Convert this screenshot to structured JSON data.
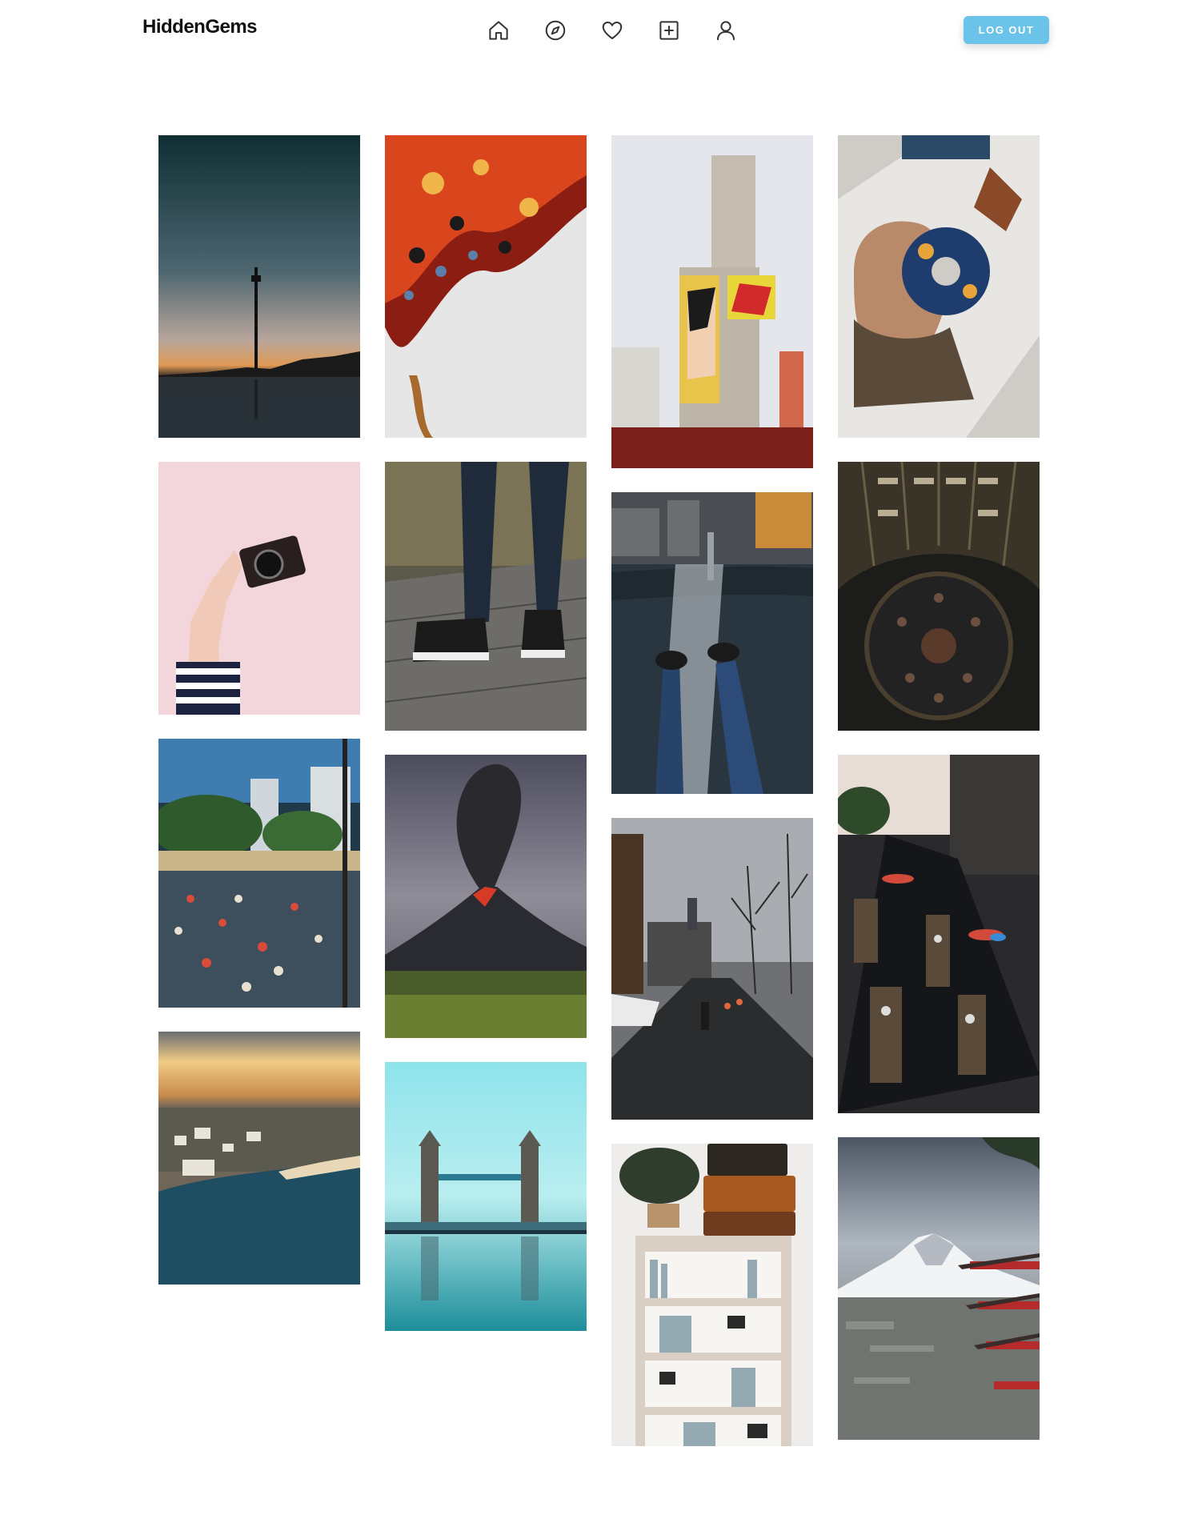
{
  "app": {
    "brand": "HiddenGems"
  },
  "nav": {
    "items": [
      {
        "name": "home",
        "icon": "home-icon"
      },
      {
        "name": "explore",
        "icon": "compass-icon"
      },
      {
        "name": "favorites",
        "icon": "heart-icon"
      },
      {
        "name": "add-post",
        "icon": "plus-square-icon"
      },
      {
        "name": "profile",
        "icon": "user-icon"
      }
    ],
    "logout_label": "LOG OUT",
    "accent": "#6cc3ea"
  },
  "gallery": {
    "columns": [
      [
        {
          "subject": "sunset-tower-reflection"
        },
        {
          "subject": "hand-holding-camera"
        },
        {
          "subject": "marathon-runners"
        },
        {
          "subject": "coastal-city-sunset"
        }
      ],
      [
        {
          "subject": "abstract-fluid-paint"
        },
        {
          "subject": "converse-sneakers"
        },
        {
          "subject": "erupting-volcano"
        },
        {
          "subject": "tower-bridge-reflection"
        }
      ],
      [
        {
          "subject": "street-art-building"
        },
        {
          "subject": "feet-above-bridge"
        },
        {
          "subject": "rainy-winter-street"
        },
        {
          "subject": "bookshelf-with-suitcases"
        }
      ],
      [
        {
          "subject": "van-gogh-scrunchie"
        },
        {
          "subject": "circular-library"
        },
        {
          "subject": "floating-market"
        },
        {
          "subject": "mount-fuji-pagoda"
        }
      ]
    ]
  }
}
